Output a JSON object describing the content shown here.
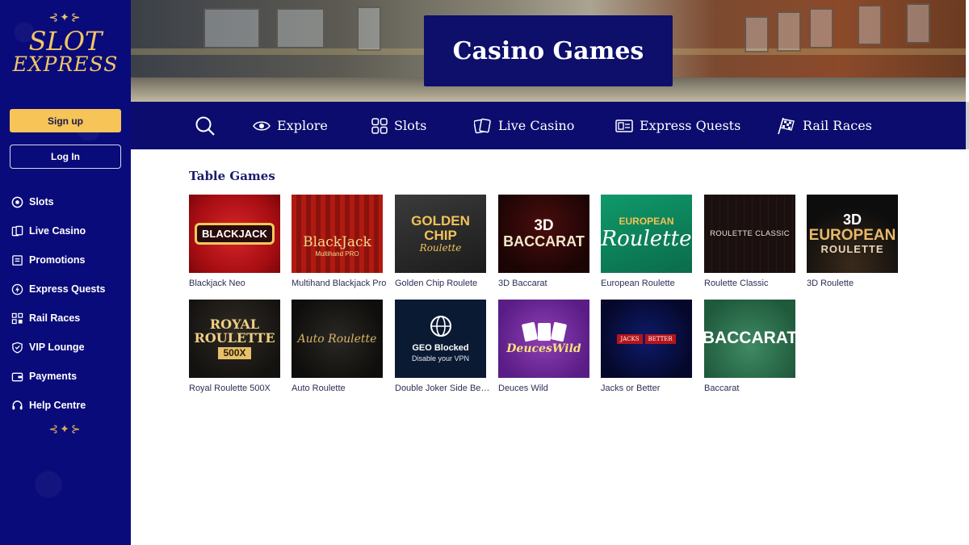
{
  "brand": {
    "line1": "SLOT",
    "line2": "EXPRESS",
    "ornament": "⊰✦⊱"
  },
  "auth": {
    "signup": "Sign up",
    "login": "Log In"
  },
  "sidebar": {
    "items": [
      {
        "label": "Slots",
        "icon": "slots-icon"
      },
      {
        "label": "Live Casino",
        "icon": "live-casino-icon"
      },
      {
        "label": "Promotions",
        "icon": "promotions-icon"
      },
      {
        "label": "Express Quests",
        "icon": "lightning-icon"
      },
      {
        "label": "Rail Races",
        "icon": "rail-races-icon"
      },
      {
        "label": "VIP Lounge",
        "icon": "vip-shield-icon"
      },
      {
        "label": "Payments",
        "icon": "wallet-icon"
      },
      {
        "label": "Help Centre",
        "icon": "headset-icon"
      }
    ]
  },
  "hero": {
    "title": "Casino Games"
  },
  "topnav": {
    "items": [
      {
        "label": "Explore",
        "icon": "eye-icon"
      },
      {
        "label": "Slots",
        "icon": "grid-icon"
      },
      {
        "label": "Live Casino",
        "icon": "cards-icon"
      },
      {
        "label": "Express Quests",
        "icon": "ticket-icon"
      },
      {
        "label": "Rail Races",
        "icon": "checkered-flag-icon"
      }
    ]
  },
  "section": {
    "title": "Table Games"
  },
  "games": [
    {
      "name": "Blackjack Neo",
      "art": "BLACKJACK"
    },
    {
      "name": "Multihand Blackjack Pro",
      "art": "BlackJack",
      "art_sub": "Multihand PRO"
    },
    {
      "name": "Golden Chip Roulete",
      "art": "GOLDEN CHIP",
      "art_sub": "Roulette"
    },
    {
      "name": "3D Baccarat",
      "art": "3D",
      "art_sub": "BACCARAT"
    },
    {
      "name": "European Roulette",
      "art": "EUROPEAN",
      "art_sub": "Roulette"
    },
    {
      "name": "Roulette Classic",
      "art": "ROULETTE CLASSIC"
    },
    {
      "name": "3D Roulette",
      "art": "3D",
      "art_sub": "EUROPEAN",
      "art_sub2": "ROULETTE"
    },
    {
      "name": "Royal Roulette 500X",
      "art": "ROYAL",
      "art_sub": "ROULETTE",
      "art_sub2": "500X"
    },
    {
      "name": "Auto Roulette",
      "art": "Auto Roulette"
    },
    {
      "name": "Double Joker Side Bet...",
      "art": "GEO Blocked",
      "art_sub": "Disable your VPN"
    },
    {
      "name": "Deuces Wild",
      "art": "DeucesWild"
    },
    {
      "name": "Jacks or Better",
      "art": "JACKS",
      "art_sub": "BETTER"
    },
    {
      "name": "Baccarat",
      "art": "BACCARAT"
    }
  ]
}
